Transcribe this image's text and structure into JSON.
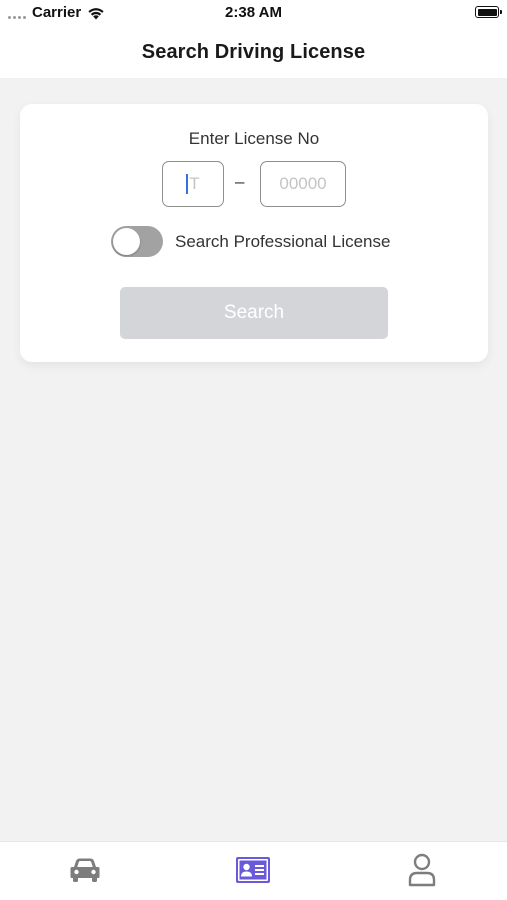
{
  "status_bar": {
    "carrier": "Carrier",
    "time": "2:38 AM"
  },
  "nav": {
    "title": "Search Driving License"
  },
  "search_form": {
    "label": "Enter License No",
    "prefix_value": "T",
    "separator": "–",
    "number_placeholder": "00000",
    "toggle_label": "Search Professional License",
    "toggle_on": false,
    "search_button": "Search",
    "search_enabled": false
  },
  "tab_bar": {
    "items": [
      {
        "icon": "car-icon",
        "active": false
      },
      {
        "icon": "id-card-icon",
        "active": true
      },
      {
        "icon": "person-icon",
        "active": false
      }
    ],
    "active_color": "#6a59d9",
    "inactive_color": "#7d7d7d"
  },
  "colors": {
    "background": "#f2f2f2",
    "card": "#ffffff",
    "button_disabled": "#d3d5d8",
    "toggle_off": "#a2a2a2",
    "caret": "#3b6fe0"
  }
}
